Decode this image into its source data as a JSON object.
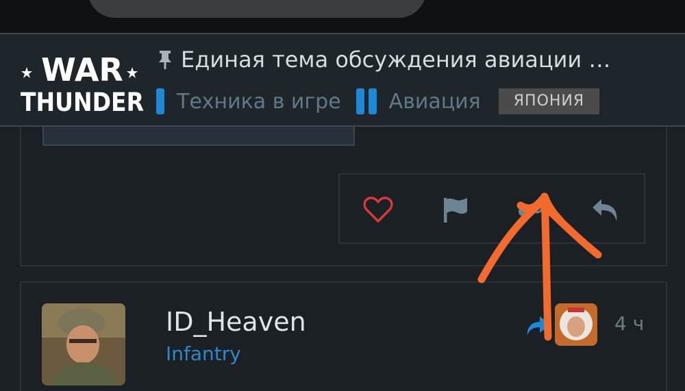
{
  "header": {
    "logo_text": [
      "WAR",
      "THUNDER"
    ],
    "topic_title": "Единая тема обсуждения авиации …",
    "breadcrumbs": [
      "Техника в игре",
      "Авиация"
    ],
    "tag": "ЯПОНИЯ"
  },
  "post_actions": {
    "icons": [
      "heart-icon",
      "flag-icon",
      "link-icon",
      "reply-icon"
    ]
  },
  "next_post": {
    "username": "ID_Heaven",
    "group": "Infantry",
    "time": "4 ч"
  },
  "colors": {
    "background": "#1a2024",
    "header_bg": "#1e262b",
    "accent_blue": "#1d88d6",
    "like_red": "#d9383a",
    "annotation_orange": "#f26a2e"
  }
}
